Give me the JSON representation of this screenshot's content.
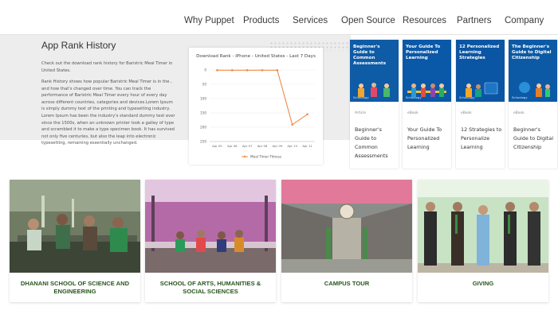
{
  "nav": {
    "items": [
      "Why Puppet",
      "Products",
      "Services",
      "Open Source",
      "Resources",
      "Partners",
      "Company"
    ]
  },
  "article": {
    "title": "App Rank History",
    "paragraphs": [
      "Check out the download rank history for Baristric Meal Timer in United States.",
      "Rank History shows how popular Baristric Meal Timer is in the , and how that's changed over time. You can track the performance of Baristric Meal Timer every hour of every day across different countries, categories and devices.Lorem Ipsum is simply dummy text of the printing and typesetting industry. Lorem Ipsum has been the industry's standard dummy text ever since the 1500s, when an unknown printer took a galley of type and scrambled it to make a type specimen book. It has survived not only five centuries, but also the leap into electronic typesetting, remaining essentially unchanged."
    ]
  },
  "chart_data": {
    "type": "line",
    "title": "Download Rank - iPhone - United States - Last 7 Days",
    "categories": [
      "Apr 05",
      "Apr 06",
      "Apr 07",
      "Apr 08",
      "Apr 09",
      "Apr 10",
      "Apr 11"
    ],
    "series": [
      {
        "name": "Meal Timer Fitness",
        "values": [
          1,
          1,
          1,
          1,
          1,
          191,
          155
        ]
      }
    ],
    "yticks": [
      "0",
      "50",
      "100",
      "150",
      "200",
      "250"
    ],
    "ylim": [
      0,
      250
    ],
    "y_inverted": true,
    "color": "#f08a4b",
    "legend": "bottom"
  },
  "resources": [
    {
      "thumb_title": "Beginner's Guide to Common Assessments",
      "kind": "Article",
      "title": "Beginner's Guide to Common Assessments",
      "color": "#0e5ba6"
    },
    {
      "thumb_title": "Your Guide To Personalized Learning",
      "kind": "eBook",
      "title": "Your Guide To Personalized Learning",
      "color": "#0a58a8"
    },
    {
      "thumb_title": "12 Personalized Learning Strategies",
      "kind": "eBook",
      "title": "12 Strategies to Personalize Learning",
      "color": "#0b56a4"
    },
    {
      "thumb_title": "The Beginner's Guide to Digital Citizenship",
      "kind": "eBook",
      "title": "Beginner's Guide to Digital Citizenship",
      "color": "#0c5aa6"
    }
  ],
  "resource_brand": "Schoology",
  "tiles": [
    {
      "caption": "DHANANI SCHOOL OF SCIENCE AND ENGINEERING"
    },
    {
      "caption": "SCHOOL OF ARTS, HUMANITIES & SOCIAL SCIENCES"
    },
    {
      "caption": "CAMPUS TOUR"
    },
    {
      "caption": "GIVING"
    }
  ]
}
